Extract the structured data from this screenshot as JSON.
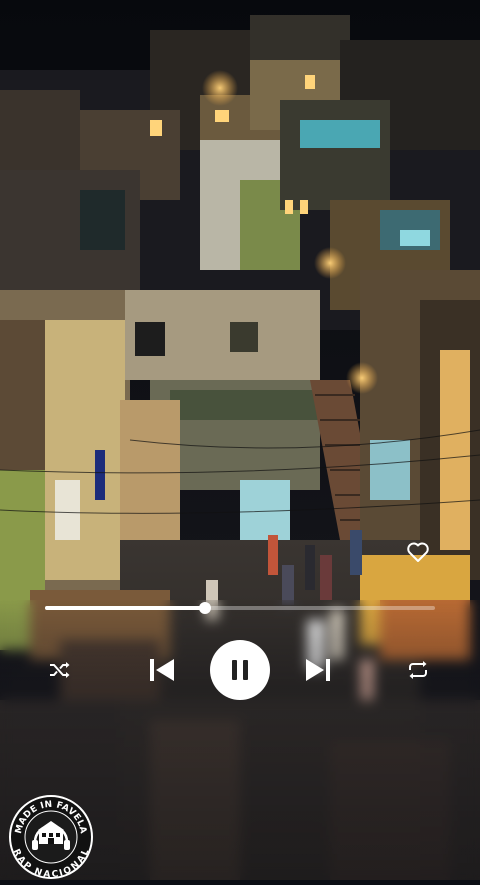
{
  "player": {
    "progress": 0.41,
    "state": "playing",
    "liked": false,
    "icons": {
      "like": "heart-outline-icon",
      "shuffle": "shuffle-icon",
      "previous": "skip-previous-icon",
      "toggle": "pause-icon",
      "next": "skip-next-icon",
      "repeat": "repeat-icon"
    }
  },
  "logo": {
    "top_text": "MADE IN FAVELA",
    "bottom_text": "RAP NACIONAL"
  },
  "colors": {
    "accent": "#ffffff",
    "track": "#8a8a8a",
    "sky": "#0b0e14",
    "lamp": "#ffb347"
  }
}
